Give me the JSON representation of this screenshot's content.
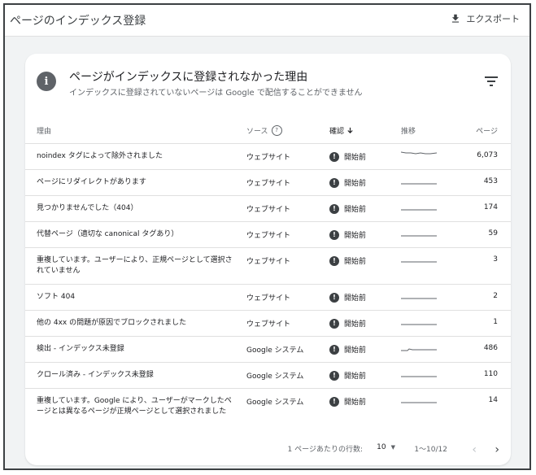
{
  "page": {
    "title": "ページのインデックス登録",
    "export_label": "エクスポート"
  },
  "card": {
    "title": "ページがインデックスに登録されなかった理由",
    "subtitle": "インデックスに登録されていないページは Google で配信することができません"
  },
  "table": {
    "headers": {
      "reason": "理由",
      "source": "ソース",
      "status": "確認",
      "trend": "推移",
      "pages": "ページ"
    },
    "rows": [
      {
        "reason": "noindex タグによって除外されました",
        "source": "ウェブサイト",
        "status": "開始前",
        "pages": "6,073"
      },
      {
        "reason": "ページにリダイレクトがあります",
        "source": "ウェブサイト",
        "status": "開始前",
        "pages": "453"
      },
      {
        "reason": "見つかりませんでした（404）",
        "source": "ウェブサイト",
        "status": "開始前",
        "pages": "174"
      },
      {
        "reason": "代替ページ（適切な canonical タグあり）",
        "source": "ウェブサイト",
        "status": "開始前",
        "pages": "59"
      },
      {
        "reason": "重複しています。ユーザーにより、正規ページとして選択されていません",
        "source": "ウェブサイト",
        "status": "開始前",
        "pages": "3"
      },
      {
        "reason": "ソフト 404",
        "source": "ウェブサイト",
        "status": "開始前",
        "pages": "2"
      },
      {
        "reason": "他の 4xx の問題が原因でブロックされました",
        "source": "ウェブサイト",
        "status": "開始前",
        "pages": "1"
      },
      {
        "reason": "検出 - インデックス未登録",
        "source": "Google システム",
        "status": "開始前",
        "pages": "486"
      },
      {
        "reason": "クロール済み - インデックス未登録",
        "source": "Google システム",
        "status": "開始前",
        "pages": "110"
      },
      {
        "reason": "重複しています。Google により、ユーザーがマークしたページとは異なるページが正規ページとして選択されました",
        "source": "Google システム",
        "status": "開始前",
        "pages": "14"
      }
    ]
  },
  "pagination": {
    "rows_per_page_label": "1 ページあたりの行数:",
    "rows_per_page_value": "10",
    "range_label": "1〜10/12"
  },
  "icons": {
    "export": "download-icon",
    "info": "info-icon",
    "filter": "filter-icon",
    "help": "help-icon",
    "sort": "arrow-down-icon",
    "status": "exclamation-icon",
    "prev": "chevron-left-icon",
    "next": "chevron-right-icon",
    "dropdown": "caret-down-icon"
  }
}
